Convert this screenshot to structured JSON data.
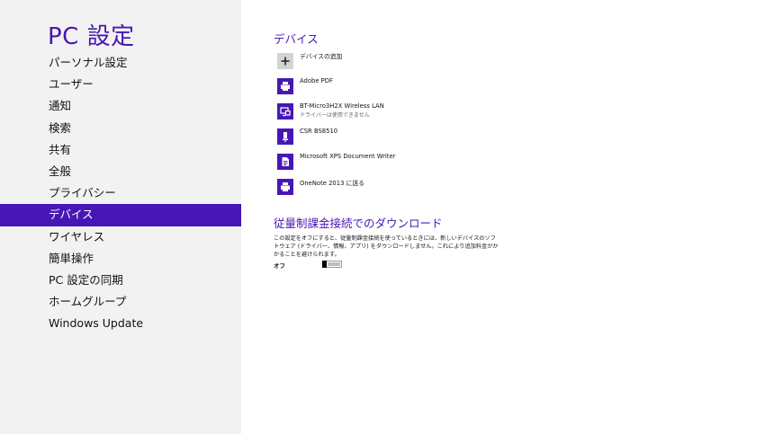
{
  "sidebar": {
    "title": "PC 設定",
    "items": [
      {
        "label": "パーソナル設定"
      },
      {
        "label": "ユーザー"
      },
      {
        "label": "通知"
      },
      {
        "label": "検索"
      },
      {
        "label": "共有"
      },
      {
        "label": "全般"
      },
      {
        "label": "プライバシー"
      },
      {
        "label": "デバイス",
        "selected": true
      },
      {
        "label": "ワイヤレス"
      },
      {
        "label": "簡単操作"
      },
      {
        "label": "PC 設定の同期"
      },
      {
        "label": "ホームグループ"
      },
      {
        "label": "Windows Update"
      }
    ]
  },
  "main": {
    "devices_title": "デバイス",
    "devices": [
      {
        "name": "デバイスの追加",
        "icon": "plus-icon"
      },
      {
        "name": "Adobe PDF",
        "icon": "printer-icon"
      },
      {
        "name": "BT-Micro3H2X Wireless LAN",
        "status": "ドライバーは使用できません",
        "icon": "network-adapter-icon"
      },
      {
        "name": "CSR BS8510",
        "icon": "usb-device-icon"
      },
      {
        "name": "Microsoft XPS Document Writer",
        "icon": "document-writer-icon"
      },
      {
        "name": "OneNote 2013 に送る",
        "icon": "printer-icon"
      }
    ],
    "metered": {
      "title": "従量制課金接続でのダウンロード",
      "description": "この設定をオフにすると、従量制課金接続を使っているときには、新しいデバイスのソフトウェア (ドライバー、情報、アプリ) をダウンロードしません。これにより追加料金がかかることを避けられます。",
      "toggle_label": "オフ",
      "toggle_on": false
    }
  },
  "colors": {
    "accent": "#4617b4",
    "sidebar_bg": "#f2f2f2",
    "add_tile": "#d4d4d4"
  }
}
